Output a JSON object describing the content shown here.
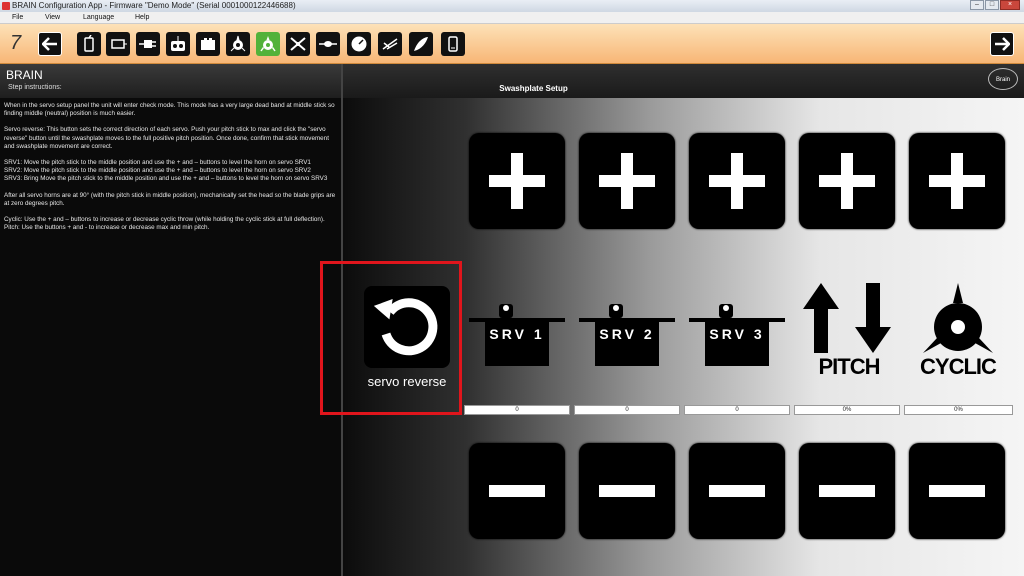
{
  "window": {
    "title": "BRAIN Configuration App - Firmware \"Demo Mode\" (Serial 0001000122446688)"
  },
  "menu": [
    "File",
    "View",
    "Language",
    "Help"
  ],
  "toolbar": {
    "step": "7",
    "icons": [
      "back-arrow-icon",
      "receiver-icon",
      "frame-icon",
      "plug-icon",
      "transmitter-icon",
      "box-icon",
      "gyro-icon",
      "swashplate-icon",
      "heli-icon",
      "tail-icon",
      "gauge-icon",
      "rescue-icon",
      "leaf-icon",
      "phone-icon",
      "next-arrow-icon"
    ],
    "active": "swashplate-icon"
  },
  "left": {
    "title": "BRAIN",
    "subtitle": "Step instructions:",
    "paragraphs": [
      "When in the servo setup panel the unit will enter check mode. This mode has a very large dead band at middle stick so finding middle (neutral) position is much easier.",
      "Servo reverse: This button sets the correct direction of each servo. Push your pitch stick to max and click the \"servo reverse\" button until the swashplate moves to the full positive pitch position. Once done, confirm that stick movement and swashplate movement are correct.",
      "SRV1: Move the pitch stick to the middle position and use the + and – buttons to level the horn on servo SRV1",
      "SRV2: Move the pitch stick to the middle position and use the + and – buttons to level the horn on servo SRV2",
      "SRV3: Bring Move the pitch stick to the middle position and use the + and – buttons to level the horn on servo SRV3",
      "After all servo horns are at 90° (with the pitch stick in middle position), mechanically set the head so the blade grips are at zero degrees pitch.",
      "Cyclic: Use the + and – buttons to increase or decrease cyclic throw (while holding the cyclic stick at full deflection).",
      "Pitch: Use the buttons + and - to increase or decrease max and min pitch."
    ]
  },
  "main": {
    "title": "Swashplate Setup",
    "logo": "Brain",
    "servo_reverse_label": "servo reverse",
    "columns": [
      {
        "label": "SRV 1",
        "value": "0"
      },
      {
        "label": "SRV 2",
        "value": "0"
      },
      {
        "label": "SRV 3",
        "value": "0"
      },
      {
        "label": "PITCH",
        "value": "0%"
      },
      {
        "label": "CYCLIC",
        "value": "0%"
      }
    ]
  },
  "colors": {
    "highlight": "#e0151c",
    "active_tool": "#52b23a",
    "toolbar": "#f7b676"
  }
}
